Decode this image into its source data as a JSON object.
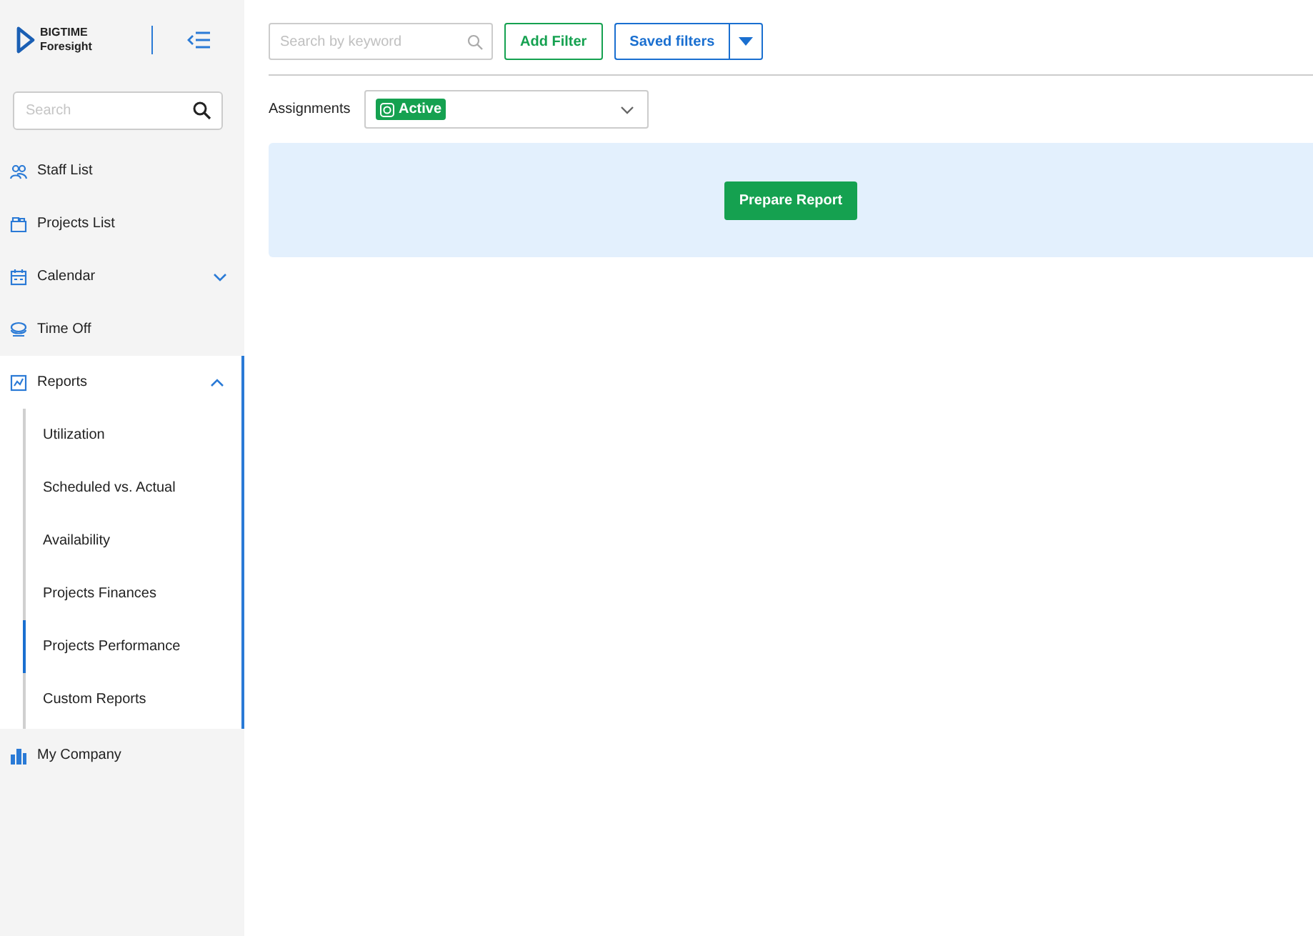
{
  "logo": {
    "line1": "BIGTIME",
    "line2": "Foresight"
  },
  "sidebar": {
    "search": {
      "placeholder": "Search"
    },
    "items": [
      {
        "label": "Staff List",
        "selected": false
      },
      {
        "label": "Projects List",
        "selected": false
      },
      {
        "label": "Calendar",
        "selected": false,
        "expanded": false
      },
      {
        "label": "Time Off",
        "selected": false
      },
      {
        "label": "Reports",
        "selected": false,
        "expanded": true,
        "children": [
          {
            "label": "Utilization",
            "selected": false
          },
          {
            "label": "Scheduled vs. Actual",
            "selected": false
          },
          {
            "label": "Availability",
            "selected": false
          },
          {
            "label": "Projects Finances",
            "selected": false
          },
          {
            "label": "Projects Performance",
            "selected": true
          },
          {
            "label": "Custom Reports",
            "selected": false
          }
        ]
      },
      {
        "label": "My Company",
        "selected": false
      }
    ]
  },
  "toolbar": {
    "search": {
      "placeholder": "Search by keyword"
    },
    "add_filter": "Add Filter",
    "saved_filters": "Saved filters"
  },
  "filter": {
    "label": "Assignments",
    "chip": "Active"
  },
  "report_panel": {
    "button": "Prepare Report"
  }
}
